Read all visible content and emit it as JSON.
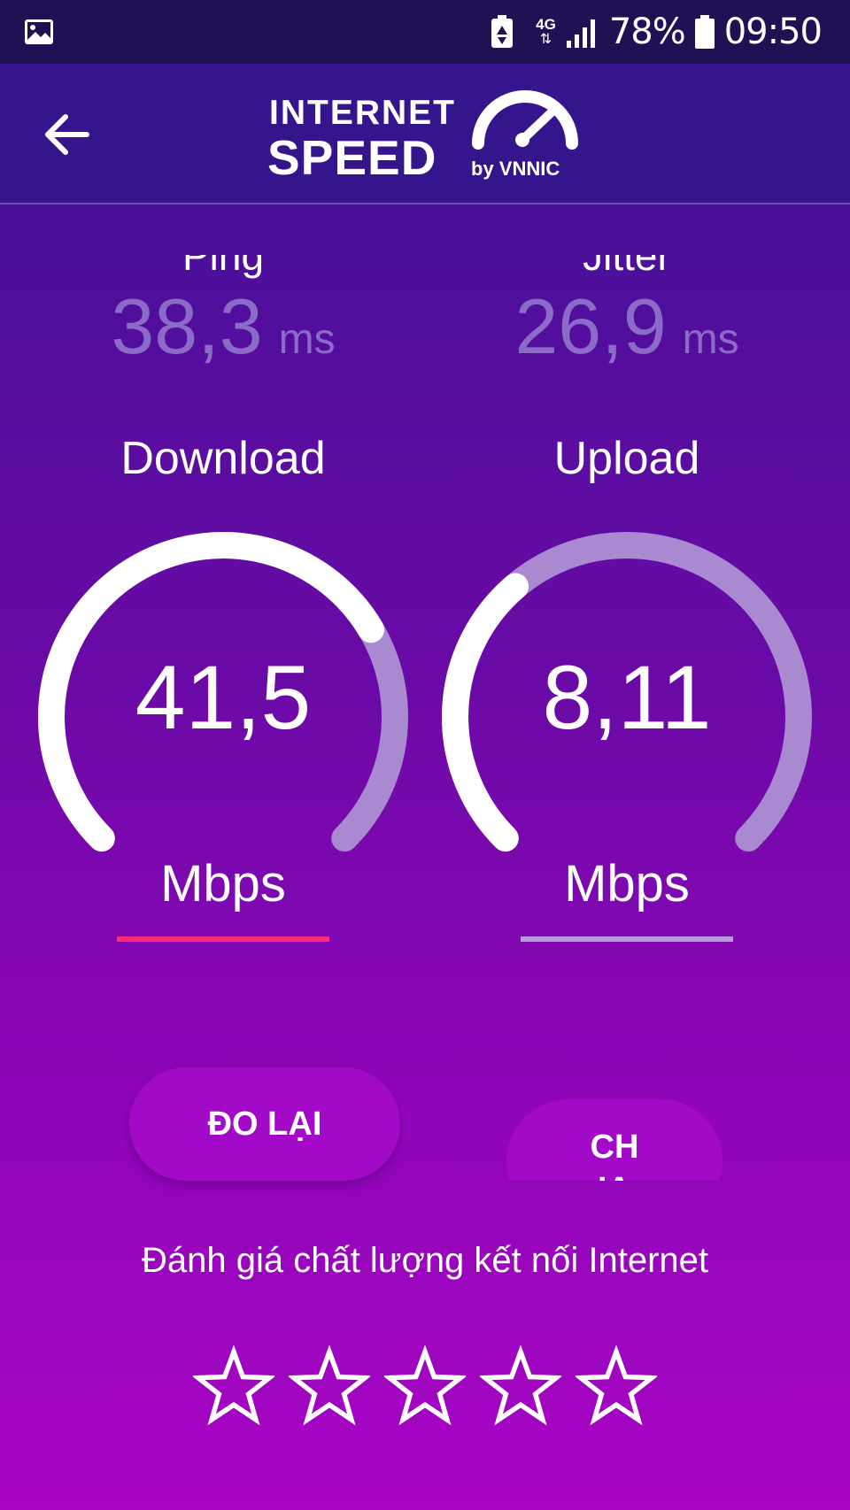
{
  "status_bar": {
    "network": "4G",
    "battery": "78%",
    "time": "09:50",
    "icons": [
      "gallery-icon",
      "battery-saver-icon",
      "data-arrows-icon",
      "signal-icon",
      "battery-icon"
    ]
  },
  "app_bar": {
    "back_icon": "arrow-left-icon",
    "logo_line1": "INTERNET",
    "logo_line2": "SPEED",
    "logo_by": "by VNNIC"
  },
  "stats": {
    "ping": {
      "label": "Ping",
      "value": "38,3",
      "unit": "ms"
    },
    "jitter": {
      "label": "Jitter",
      "value": "26,9",
      "unit": "ms"
    }
  },
  "download": {
    "label": "Download",
    "value": "41,5",
    "unit": "Mbps",
    "gauge_fraction": 0.72,
    "underline_color": "#ff2a7a"
  },
  "upload": {
    "label": "Upload",
    "value": "8,11",
    "unit": "Mbps",
    "gauge_fraction": 0.35,
    "underline_color": "#b39dd6"
  },
  "buttons": {
    "retry": "ĐO LẠI",
    "share": "CH\nIA"
  },
  "rating": {
    "prompt": "Đánh giá chất lượng kết nối Internet",
    "stars": 5,
    "selected": 0
  },
  "colors": {
    "track": "#a98ad0",
    "fill": "#ffffff",
    "statusbar": "#221055",
    "appbar": "#35158c",
    "button": "#a20ac8"
  }
}
